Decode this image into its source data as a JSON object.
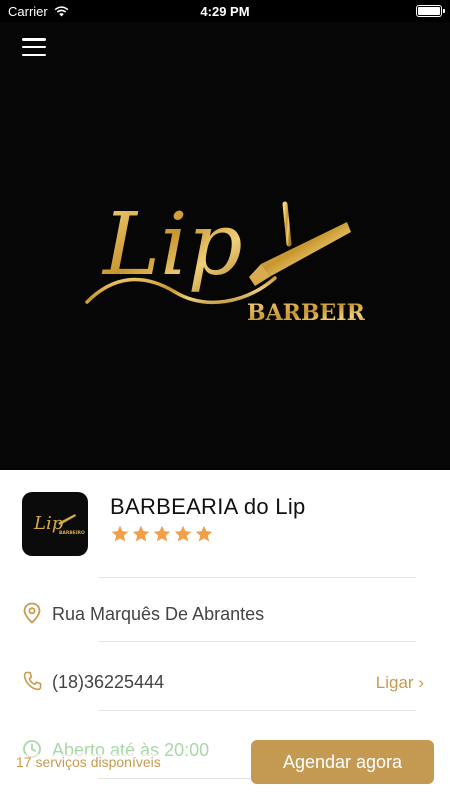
{
  "status_bar": {
    "carrier": "Carrier",
    "time": "4:29 PM"
  },
  "hero": {
    "logo_text": "Lip",
    "logo_subtext": "BARBEIRO",
    "icons": [
      "menu-icon",
      "razor-icon"
    ]
  },
  "shop": {
    "name": "BARBEARIA do Lip",
    "rating": 5,
    "avatar_logo_text": "Lip",
    "avatar_logo_subtext": "BARBEIRO",
    "address": "Rua Marquês De Abrantes",
    "phone": "(18)36225444",
    "call_label": "Ligar",
    "call_chevron": "›",
    "hours": "Aberto até às 20:00"
  },
  "footer": {
    "services_count": "17 serviços disponíveis",
    "book_label": "Agendar agora"
  },
  "colors": {
    "accent": "#c49a52",
    "gold_text": "#c79a4e",
    "star": "#f0a04b",
    "open_status": "#a8d8a8"
  }
}
